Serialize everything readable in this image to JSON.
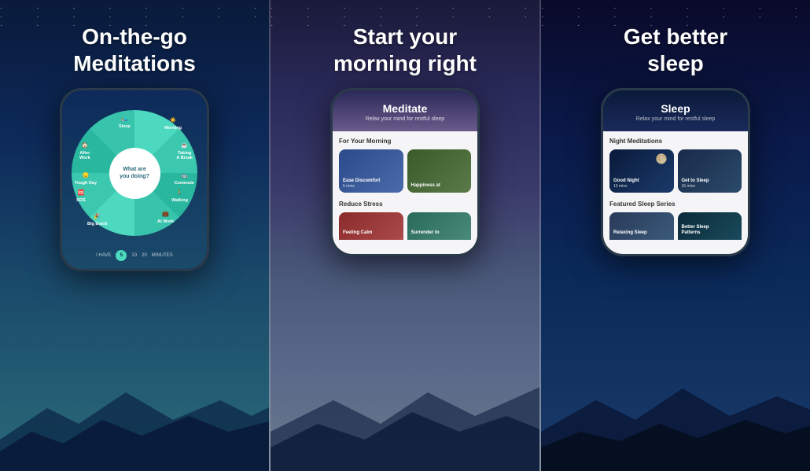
{
  "panels": [
    {
      "id": "panel-1",
      "title": "On-the-go\nMeditations",
      "wheel": {
        "center_text": "What are\nyou doing?",
        "labels": [
          "Sleep",
          "Morning",
          "Taking\nA Break",
          "Commute",
          "Walking",
          "At Work",
          "Big Event",
          "SOS",
          "Tough Day",
          "After\nWork"
        ],
        "icons": [
          "🛌",
          "☀️",
          "☕",
          "🚌",
          "🚶",
          "💼",
          "🎉",
          "🆘",
          "😞",
          "🏠"
        ]
      },
      "timer": {
        "prefix": "I HAVE",
        "values": [
          "5",
          "10",
          "20"
        ],
        "suffix": "MINUTES"
      }
    },
    {
      "id": "panel-2",
      "title": "Start your\nmorning right",
      "screen": {
        "header_title": "Meditate",
        "header_subtitle": "Relax your mind for restful sleep",
        "sections": [
          {
            "title": "For Your Morning",
            "cards": [
              {
                "label": "Ease Discomfort",
                "duration": "5 mins",
                "bg": "card-bg-1"
              },
              {
                "label": "Happiness at",
                "duration": "",
                "bg": "card-bg-2"
              }
            ]
          },
          {
            "title": "Reduce Stress",
            "cards": [
              {
                "label": "Feeling Calm",
                "duration": "",
                "bg": "card-bg-3"
              },
              {
                "label": "Surrender to",
                "duration": "",
                "bg": "card-bg-4"
              }
            ]
          }
        ]
      }
    },
    {
      "id": "panel-3",
      "title": "Get better\nsleep",
      "screen": {
        "header_title": "Sleep",
        "header_subtitle": "Relax your mind for restful sleep",
        "sections": [
          {
            "title": "Night Meditations",
            "cards": [
              {
                "label": "Good Night",
                "duration": "10 mins",
                "bg": "sleep-card-bg-1"
              },
              {
                "label": "Get to Sleep",
                "duration": "15 mins",
                "bg": "sleep-card-bg-2"
              }
            ]
          },
          {
            "title": "Featured Sleep Series",
            "cards": [
              {
                "label": "Relaxing Sleep",
                "duration": "",
                "bg": "sleep-card-bg-3"
              },
              {
                "label": "Better Sleep\nPatterns",
                "duration": "",
                "bg": "sleep-card-bg-4"
              }
            ]
          }
        ]
      }
    }
  ]
}
